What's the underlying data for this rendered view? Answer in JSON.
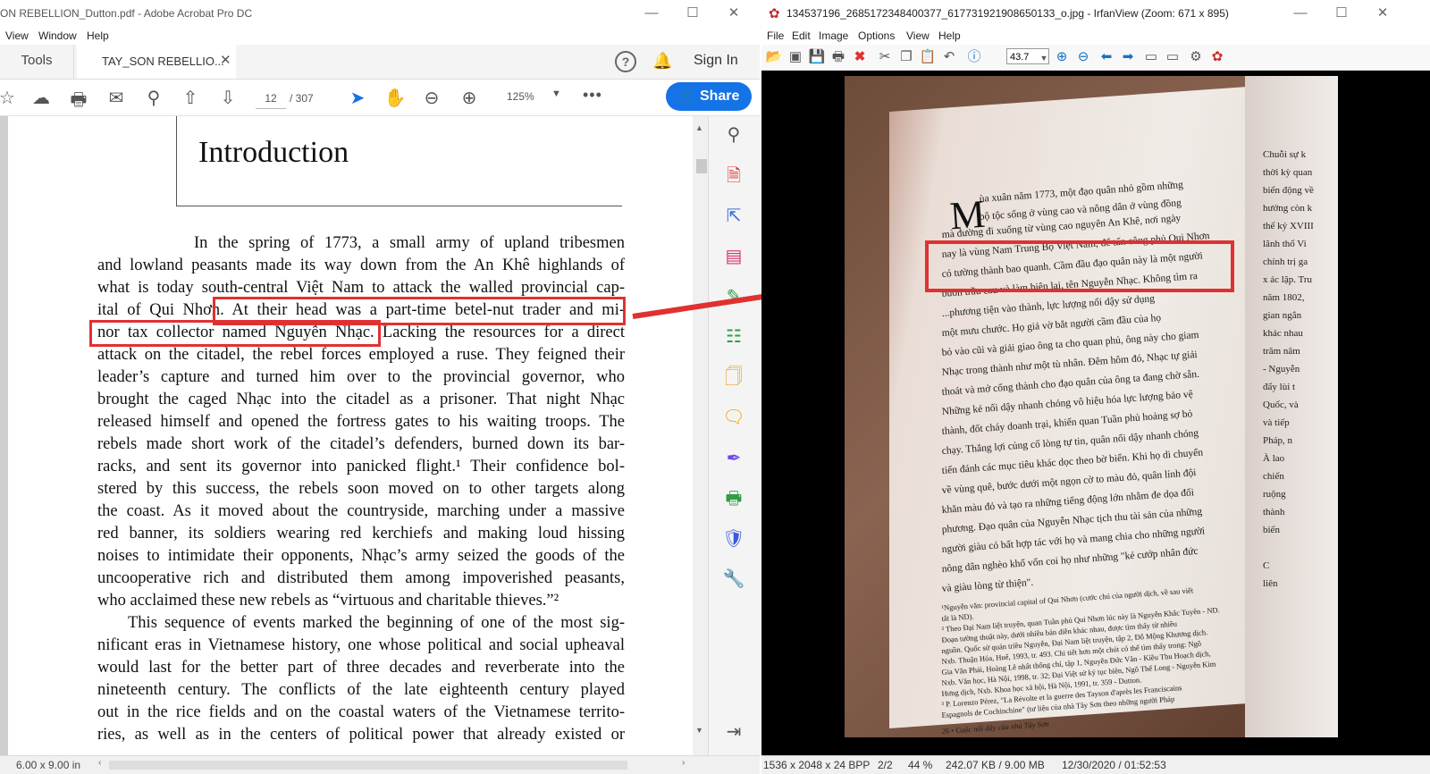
{
  "acrobat": {
    "title": "ON REBELLION_Dutton.pdf - Adobe Acrobat Pro DC",
    "menu": [
      "View",
      "Window",
      "Help"
    ],
    "tools_tab": "Tools",
    "doc_tab": "TAY_SON REBELLIO...",
    "sign_in": "Sign In",
    "page_current": "12",
    "page_total": "/ 307",
    "zoom": "125%",
    "share": "Share",
    "page_size": "6.00 x 9.00 in",
    "heading": "Introduction",
    "lines": [
      "In the spring of 1773, a small army of upland tribesmen",
      "and lowland peasants made its way down from the An Khê highlands of",
      "what is today south-central Việt Nam to attack the walled provincial cap-",
      "ital of Qui Nhơn. At their head was a part-time betel-nut trader and mi-",
      "nor tax collector named Nguyễn Nhạc. Lacking the resources for a direct",
      "attack on the citadel, the rebel forces employed a ruse. They feigned their",
      "leader’s capture and turned him over to the provincial governor, who",
      "brought the caged Nhạc into the citadel as a prisoner. That night Nhạc",
      "released himself and opened the fortress gates to his waiting troops. The",
      "rebels made short work of the citadel’s defenders, burned down its bar-",
      "racks, and sent its governor into panicked flight.¹ Their confidence bol-",
      "stered by this success, the rebels soon moved on to other targets along",
      "the coast. As it moved about the countryside, marching under a massive",
      "red banner, its soldiers wearing red kerchiefs and making loud hissing",
      "noises to intimidate their opponents, Nhạc’s army seized the goods of the",
      "uncooperative rich and distributed them among impoverished peasants,",
      "who acclaimed these new rebels as “virtuous and charitable thieves.”²",
      "This sequence of events marked the beginning of one of the most sig-",
      "nificant eras in Vietnamese history, one whose political and social upheaval",
      "would last for the better part of three decades and reverberate into the",
      "nineteenth century. The conflicts of the late eighteenth century played",
      "out in the rice fields and on the coastal waters of the Vietnamese territo-",
      "ries, as well as in the centers of political power that already existed or"
    ]
  },
  "irfan": {
    "title": "134537196_2685172348400377_617731921908650133_o.jpg - IrfanView (Zoom: 671 x 895)",
    "menu": [
      "File",
      "Edit",
      "Image",
      "Options",
      "View",
      "Help"
    ],
    "zoom": "43.7",
    "status": {
      "dims": "1536 x 2048 x 24 BPP",
      "index": "2/2",
      "percent": "44 %",
      "size": "242.07 KB / 9.00 MB",
      "datetime": "12/30/2020 / 01:52:53"
    },
    "photo_dropcap": "M",
    "photo_lines": [
      "ùa xuân năm 1773, một đạo quân nhỏ gồm những",
      "bộ tộc sống ở vùng cao và nông dân ở vùng đồng",
      "mà đường đi xuống từ vùng cao nguyên An Khê, nơi ngày",
      "nay là vùng Nam Trung Bộ Việt Nam, để tấn công phủ Qui Nhơn",
      "có tường thành bao quanh. Cầm đầu đạo quân này là một người",
      "buôn trầu cau và làm biện lại, tên Nguyễn Nhạc. Không tìm ra",
      "...phương tiện vào thành, lực lượng nổi dậy sử dụng",
      "một mưu chước. Họ giả vờ bắt người cầm đầu của họ",
      "bỏ vào cũi và giải giao ông ta cho quan phủ, ông này cho giam",
      "Nhạc trong thành như một tù nhân. Đêm hôm đó, Nhạc tự giải",
      "thoát và mở cổng thành cho đạo quân của ông ta đang chờ sẵn.",
      "Những kẻ nổi dậy nhanh chóng vô hiệu hóa lực lượng bảo vệ",
      "thành, đốt cháy doanh trại, khiến quan Tuần phủ hoảng sợ bỏ",
      "chạy. Thắng lợi củng cố lòng tự tin, quân nổi dậy nhanh chóng",
      "tiến đánh các mục tiêu khác dọc theo bờ biển. Khi họ di chuyển",
      "về vùng quê, bước dưới một ngọn cờ to màu đỏ, quân lính đội",
      "khăn màu đỏ và tạo ra những tiếng động lớn nhằm đe dọa đối",
      "phương. Đạo quân của Nguyễn Nhạc tịch thu tài sản của những",
      "người giàu có bất hợp tác với họ và mang chia cho những người",
      "nông dân nghèo khổ vốn coi họ như những \"kẻ cướp nhân đức",
      "và giàu lòng từ thiện\"."
    ],
    "photo_footnotes": [
      "¹Nguyễn văn: provincial capital of Qui Nhơn (cước chú của người dịch, về sau viết",
      "tắt là ND).",
      "² Theo Đại Nam liệt truyện, quan Tuần phủ Qui Nhơn lúc này là Nguyễn Khắc Tuyên - ND.",
      "Đoạn tường thuật này, dưới nhiều bản diễn khác nhau, được tìm thấy từ nhiều",
      "nguồn. Quốc sử quán triều Nguyễn, Đại Nam liệt truyện, tập 2, Đỗ Mộng Khương dịch.",
      "Nxb. Thuận Hóa, Huế, 1993, tr. 493. Chi tiết hơn một chút có thể tìm thấy trong: Ngô",
      "Gia Văn Phái, Hoàng Lê nhất thống chí, tập 1, Nguyễn Đức Vân - Kiều Thu Hoạch dịch,",
      "Nxb. Văn học, Hà Nội, 1998, tr. 32; Đại Việt sử ký tục biên, Ngô Thế Long - Nguyễn Kim",
      "Hưng dịch, Nxb. Khoa học xã hội, Hà Nội, 1991, tr. 359 - Dutton.",
      "³ P. Lorenzo Pérez, \"La Révolte et la guerre des Tayson d'après les Franciscains",
      "Espagnols de Cochinchine\" (tư liệu của nhà Tây Sơn theo những người Pháp"
    ],
    "photo_page_footer": "26  •  Cuộc nổi dậy của nhà Tây Sơn",
    "photo_right_lines": [
      "Chuỗi sự k",
      "thời kỳ quan",
      "biến động về",
      "hưởng còn k",
      "thế kỷ XVIII",
      "lãnh thổ Vi",
      "chính trị ga",
      "x ác lập. Tru",
      "năm 1802,",
      "gian ngắn",
      "khác nhau",
      "trăm năm",
      "- Nguyễn",
      "đẩy lùi t",
      "Quốc, và",
      "và tiếp",
      "Pháp, n",
      "À lao",
      "chiến",
      "ruộng",
      "thành",
      "biến",
      "",
      "C",
      "liên"
    ]
  }
}
